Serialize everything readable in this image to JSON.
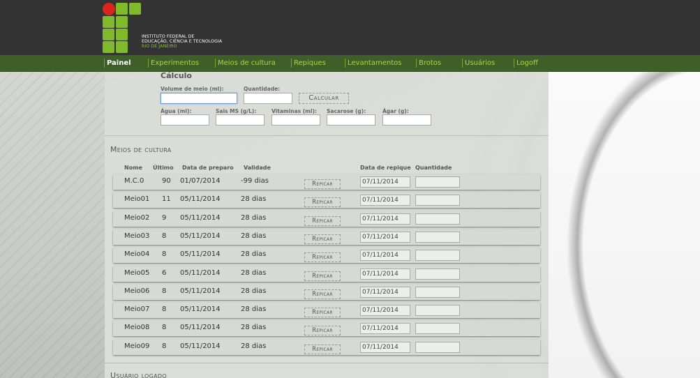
{
  "logo": {
    "line1": "INSTITUTO FEDERAL DE",
    "line2": "EDUCAÇÃO, CIÊNCIA E TECNOLOGIA",
    "line3": "RIO DE JANEIRO"
  },
  "nav": [
    "Painel",
    "Experimentos",
    "Meios de cultura",
    "Repiques",
    "Levantamentos",
    "Brotos",
    "Usuários",
    "Logoff"
  ],
  "calc": {
    "title": "Cálculo",
    "volume_label": "Volume de meio (ml):",
    "quantidade_label": "Quantidade:",
    "button": "Calcular",
    "fields": [
      "Água (ml):",
      "Sais MS (g/L):",
      "Vitaminas (ml):",
      "Sacarose (g):",
      "Ágar (g):"
    ]
  },
  "meios": {
    "title": "Meios de cultura",
    "headers": {
      "nome": "Nome",
      "ultimo": "Último",
      "data_preparo": "Data de preparo",
      "validade": "Validade",
      "data_repique": "Data de repique",
      "quantidade": "Quantidade"
    },
    "repicar_label": "Repicar",
    "rows": [
      {
        "nome": "M.C.0",
        "ultimo": "90",
        "data": "01/07/2014",
        "validade": "-99 dias",
        "repique": "07/11/2014"
      },
      {
        "nome": "Meio01",
        "ultimo": "11",
        "data": "05/11/2014",
        "validade": "28 dias",
        "repique": "07/11/2014"
      },
      {
        "nome": "Meio02",
        "ultimo": "9",
        "data": "05/11/2014",
        "validade": "28 dias",
        "repique": "07/11/2014"
      },
      {
        "nome": "Meio03",
        "ultimo": "8",
        "data": "05/11/2014",
        "validade": "28 dias",
        "repique": "07/11/2014"
      },
      {
        "nome": "Meio04",
        "ultimo": "8",
        "data": "05/11/2014",
        "validade": "28 dias",
        "repique": "07/11/2014"
      },
      {
        "nome": "Meio05",
        "ultimo": "6",
        "data": "05/11/2014",
        "validade": "28 dias",
        "repique": "07/11/2014"
      },
      {
        "nome": "Meio06",
        "ultimo": "8",
        "data": "05/11/2014",
        "validade": "28 dias",
        "repique": "07/11/2014"
      },
      {
        "nome": "Meio07",
        "ultimo": "8",
        "data": "05/11/2014",
        "validade": "28 dias",
        "repique": "07/11/2014"
      },
      {
        "nome": "Meio08",
        "ultimo": "8",
        "data": "05/11/2014",
        "validade": "28 dias",
        "repique": "07/11/2014"
      },
      {
        "nome": "Meio09",
        "ultimo": "8",
        "data": "05/11/2014",
        "validade": "28 dias",
        "repique": "07/11/2014"
      }
    ]
  },
  "usuario": {
    "title": "Usuário logado"
  },
  "colors": {
    "header_bg": "#333333",
    "nav_bg": "#3f5f28",
    "nav_link": "#a8d64e",
    "logo_green": "#7fba2a",
    "logo_red": "#d9261c"
  }
}
